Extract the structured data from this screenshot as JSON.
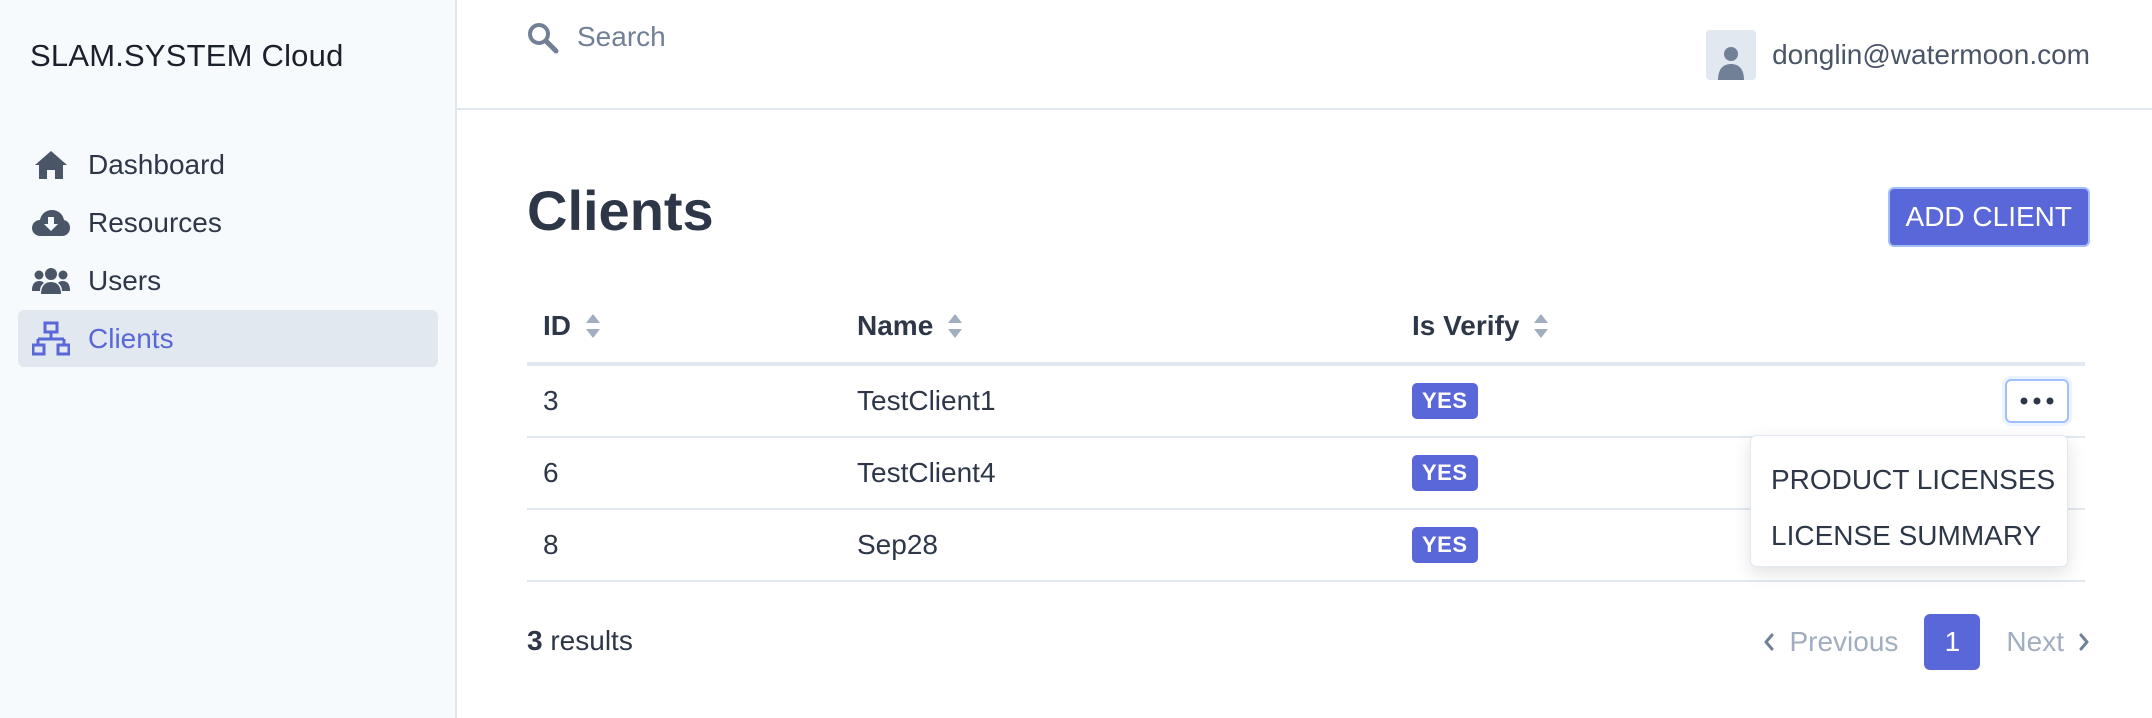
{
  "app": {
    "brand": "SLAM.SYSTEM Cloud"
  },
  "sidebar": {
    "items": [
      {
        "label": "Dashboard",
        "icon": "home-icon",
        "active": false
      },
      {
        "label": "Resources",
        "icon": "cloud-download-icon",
        "active": false
      },
      {
        "label": "Users",
        "icon": "users-icon",
        "active": false
      },
      {
        "label": "Clients",
        "icon": "network-icon",
        "active": true
      }
    ]
  },
  "header": {
    "search_placeholder": "Search",
    "user_email": "donglin@watermoon.com"
  },
  "page": {
    "title": "Clients",
    "add_button": "ADD CLIENT"
  },
  "table": {
    "columns": [
      "ID",
      "Name",
      "Is Verify"
    ],
    "rows": [
      {
        "id": "3",
        "name": "TestClient1",
        "verify": "YES"
      },
      {
        "id": "6",
        "name": "TestClient4",
        "verify": "YES"
      },
      {
        "id": "8",
        "name": "Sep28",
        "verify": "YES"
      }
    ]
  },
  "dropdown": {
    "items": [
      "PRODUCT LICENSES",
      "LICENSE SUMMARY"
    ]
  },
  "footer": {
    "result_count": "3",
    "result_label": "results",
    "previous": "Previous",
    "current_page": "1",
    "next": "Next"
  },
  "colors": {
    "accent": "#5a67d8",
    "sidebar_bg": "#f7fafc",
    "active_bg": "#e2e8f0",
    "icon": "#4a5568"
  }
}
